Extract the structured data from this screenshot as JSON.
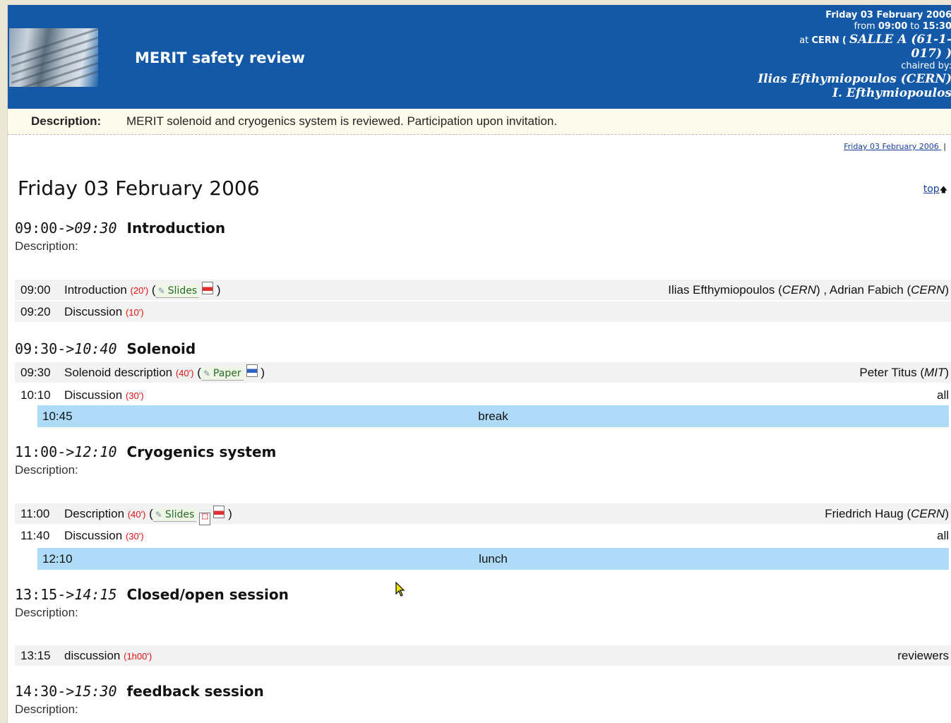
{
  "header": {
    "title": "MERIT safety review",
    "date": "Friday 03 February 2006",
    "from_prefix": "from",
    "start": "09:00",
    "to_word": "to",
    "end": "15:30",
    "at_prefix": "at",
    "institution": "CERN",
    "room_open": "(",
    "room_line1": "SALLE A (61-1-",
    "room_line2": "017) )",
    "chaired_label": "chaired by:",
    "chair1": "Ilias Efthymiopoulos (CERN)",
    "chair2": "I. Efthymiopoulos"
  },
  "description": {
    "label": "Description:",
    "text": "MERIT solenoid and cryogenics system is reviewed. Participation upon invitation."
  },
  "nav": {
    "date_link": "Friday 03 February 2006",
    "separator": "|",
    "top_link": "top",
    "top_arrow": "🡅"
  },
  "day_heading": "Friday 03 February 2006",
  "description_label": "Description:",
  "sessions": [
    {
      "start": "09:00->",
      "end": "09:30",
      "name": "Introduction",
      "items": [
        {
          "time": "09:00",
          "title": "Introduction",
          "duration": "(20')",
          "material": "Slides",
          "open_paren": "(",
          "close_paren": ")",
          "speaker1": "Ilias Efthymiopoulos",
          "aff1": "CERN",
          "sep": " , ",
          "speaker2": "Adrian Fabich",
          "aff2": "CERN"
        },
        {
          "time": "09:20",
          "title": "Discussion",
          "duration": "(10')"
        }
      ]
    },
    {
      "start": "09:30->",
      "end": "10:40",
      "name": "Solenoid",
      "items": [
        {
          "time": "09:30",
          "title": "Solenoid description",
          "duration": "(40')",
          "material": "Paper",
          "speaker1": "Peter Titus",
          "aff1": "MIT"
        },
        {
          "time": "10:10",
          "title": "Discussion",
          "duration": "(30')",
          "speakers": "all"
        }
      ],
      "break": {
        "time": "10:45",
        "label": "break"
      }
    },
    {
      "start": "11:00->",
      "end": "12:10",
      "name": "Cryogenics system",
      "items": [
        {
          "time": "11:00",
          "title": "Description",
          "duration": "(40')",
          "material": "Slides",
          "speaker1": "Friedrich Haug",
          "aff1": "CERN"
        },
        {
          "time": "11:40",
          "title": "Discussion",
          "duration": "(30')",
          "speakers": "all"
        }
      ],
      "break": {
        "time": "12:10",
        "label": "lunch"
      }
    },
    {
      "start": "13:15->",
      "end": "14:15",
      "name": "Closed/open session",
      "items": [
        {
          "time": "13:15",
          "title": "discussion",
          "duration": "(1h00')",
          "speakers": "reviewers"
        }
      ]
    },
    {
      "start": "14:30->",
      "end": "15:30",
      "name": "feedback session"
    }
  ],
  "colors": {
    "header_bg": "#1459a8",
    "break_bg": "#aedcf8",
    "duration": "#e01010",
    "link": "#1a3fa0"
  }
}
